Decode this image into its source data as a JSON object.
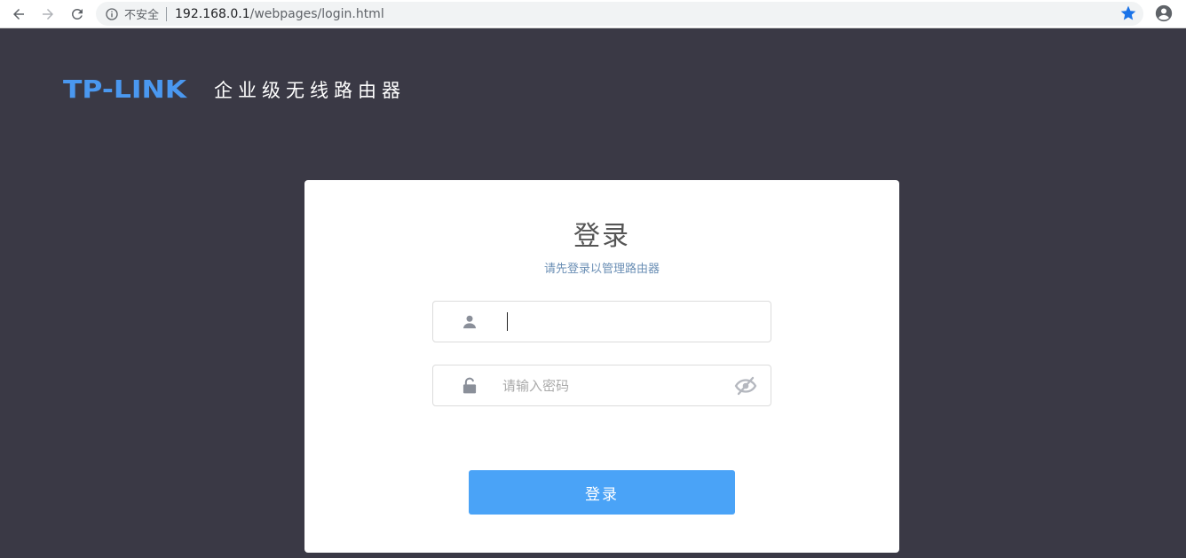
{
  "browser": {
    "security_label": "不安全",
    "url_host": "192.168.0.1",
    "url_path": "/webpages/login.html"
  },
  "header": {
    "logo_text": "TP-LINK",
    "product_name": "企业级无线路由器",
    "logo_color": "#4a98f0"
  },
  "login": {
    "title": "登录",
    "subtitle": "请先登录以管理路由器",
    "username_value": "",
    "password_value": "",
    "password_placeholder": "请输入密码",
    "submit_label": "登录",
    "button_color": "#4aa3f7"
  },
  "icons": {
    "back": "arrow-left-icon",
    "forward": "arrow-right-icon",
    "reload": "reload-icon",
    "info": "info-icon",
    "bookmark": "star-icon",
    "account": "account-icon",
    "user": "user-icon",
    "lock": "lock-icon",
    "password_visibility": "eye-slash-icon"
  }
}
